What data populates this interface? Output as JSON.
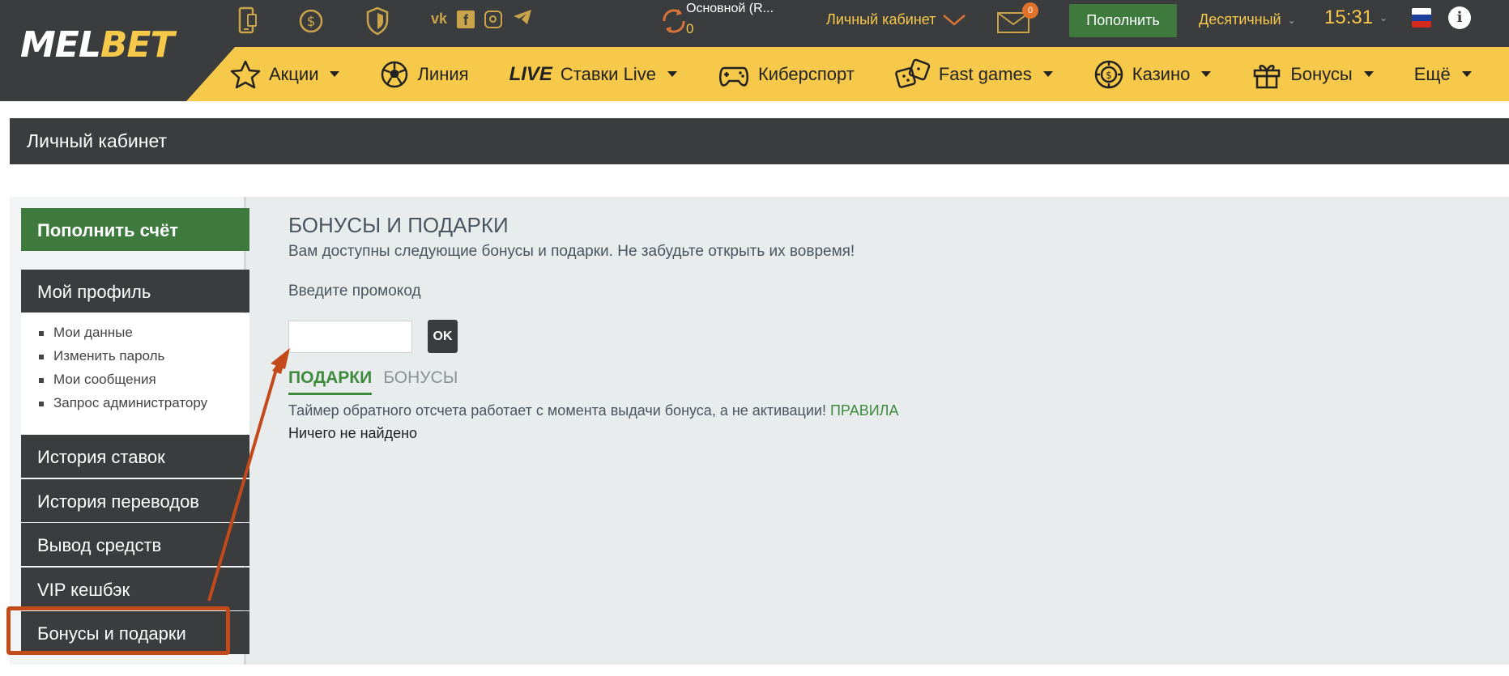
{
  "header": {
    "logo_part1": "MEL",
    "logo_part2": "BET",
    "balance_label": "Основной (R...",
    "balance_value": "0",
    "cabinet_label": "Личный кабинет",
    "mail_count": "0",
    "deposit_label": "Пополнить",
    "odds_format": "Десятичный",
    "time": "15:31",
    "info_symbol": "i",
    "social": [
      "vk",
      "f",
      "ig",
      "tg"
    ]
  },
  "nav": {
    "items": [
      {
        "label": "Акции",
        "icon": "star-icon",
        "dropdown": true
      },
      {
        "label": "Линия",
        "icon": "soccer-ball-icon",
        "dropdown": false
      },
      {
        "label": "Ставки Live",
        "tag": "LIVE",
        "dropdown": true
      },
      {
        "label": "Киберспорт",
        "icon": "gamepad-icon",
        "dropdown": false
      },
      {
        "label": "Fast games",
        "icon": "dice-icon",
        "dropdown": true
      },
      {
        "label": "Казино",
        "icon": "casino-chip-icon",
        "dropdown": true
      },
      {
        "label": "Бонусы",
        "icon": "gift-icon",
        "dropdown": true
      },
      {
        "label": "Ещё",
        "dropdown": true
      }
    ]
  },
  "page": {
    "title": "Личный кабинет"
  },
  "sidebar": {
    "deposit_label": "Пополнить счёт",
    "profile_label": "Мой профиль",
    "profile_links": [
      "Мои данные",
      "Изменить пароль",
      "Мои сообщения",
      "Запрос администратору"
    ],
    "bet_history_label": "История ставок",
    "transfer_history_label": "История переводов",
    "withdraw_label": "Вывод средств",
    "vip_label": "VIP кешбэк",
    "bonuses_label": "Бонусы и подарки"
  },
  "main": {
    "heading": "БОНУСЫ И ПОДАРКИ",
    "subtitle": "Вам доступны следующие бонусы и подарки. Не забудьте открыть их вовремя!",
    "promo_label": "Введите промокод",
    "promo_value": "",
    "ok_label": "OK",
    "tab_gifts": "ПОДАРКИ",
    "tab_bonuses": "БОНУСЫ",
    "timer_text": "Таймер обратного отсчета работает с момента выдачи бонуса, а не активации!",
    "rules_link": "ПРАВИЛА",
    "empty_text": "Ничего не найдено"
  },
  "colors": {
    "header_bg": "#3b3c3e",
    "nav_yellow": "#f6c94b",
    "accent_green": "#3e7a3d",
    "annotation": "#c34a1a"
  }
}
